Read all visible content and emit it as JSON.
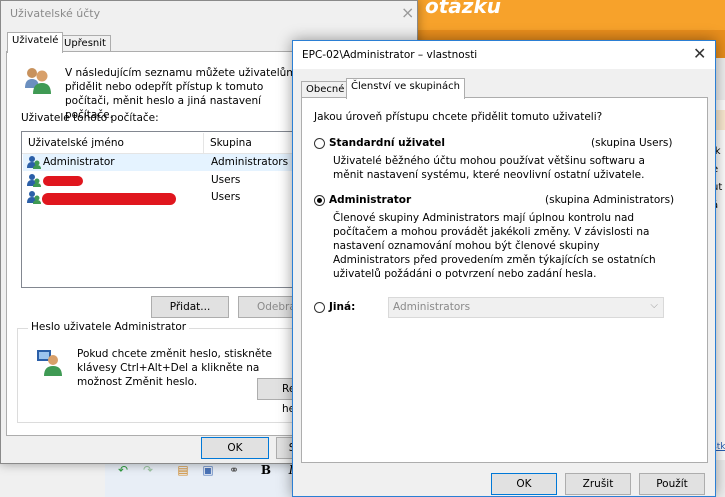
{
  "background": {
    "logo_fragment": "otázku",
    "side_letters": [
      "ik",
      "e",
      "ut",
      "á"
    ],
    "side_link": "stky"
  },
  "accounts": {
    "title": "Uživatelské účty",
    "close": "×",
    "tabs": [
      "Uživatelé",
      "Upřesnit"
    ],
    "intro": "V následujícím seznamu můžete uživatelům přidělit nebo odepřít přístup k tomuto počítači, měnit heslo a jiná nastavení počítače.",
    "users_label": "Uživatelé tohoto počítače:",
    "columns": [
      "Uživatelské jméno",
      "Skupina"
    ],
    "rows": [
      {
        "name": "Administrator",
        "group": "Administrators"
      },
      {
        "name": "",
        "group": "Users"
      },
      {
        "name": "",
        "group": "Users"
      }
    ],
    "add_button": "Přidat...",
    "remove_button": "Odebrat",
    "password_group": "Heslo uživatele Administrator",
    "password_text": "Pokud chcete změnit heslo, stiskněte klávesy Ctrl+Alt+Del a klikněte na možnost Změnit heslo.",
    "reset_button": "Resetovat heslo...",
    "ok_button": "OK",
    "cancel_button": "Storno"
  },
  "properties": {
    "title": "EPC-02\\Administrator – vlastnosti",
    "close": "✕",
    "tabs": [
      "Obecné",
      "Členství ve skupinách"
    ],
    "question": "Jakou úroveň přístupu chcete přidělit tomuto uživateli?",
    "options": [
      {
        "label": "Standardní uživatel",
        "group": "(skupina Users)",
        "desc": "Uživatelé běžného účtu mohou používat většinu softwaru a měnit nastavení systému, které neovlivní ostatní uživatele.",
        "checked": false
      },
      {
        "label": "Administrator",
        "group": "(skupina Administrators)",
        "desc": "Členové skupiny Administrators mají úplnou kontrolu nad počítačem a mohou provádět jakékoli změny. V závislosti na nastavení oznamování mohou být členové skupiny Administrators před provedením změn týkajících se ostatních uživatelů požádáni o potvrzení nebo zadání hesla.",
        "checked": true
      }
    ],
    "other_label": "Jiná:",
    "other_value": "Administrators",
    "ok_button": "OK",
    "cancel_button": "Zrušit",
    "apply_button": "Použít"
  }
}
